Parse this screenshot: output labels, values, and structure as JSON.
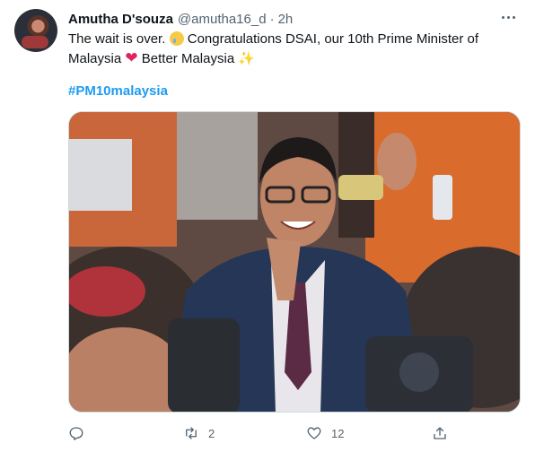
{
  "user": {
    "display_name": "Amutha D'souza",
    "handle": "@amutha16_d",
    "separator": "·",
    "time": "2h",
    "avatar_icon": "profile-avatar"
  },
  "tweet": {
    "line1": "The wait is over.",
    "line1b": "Congratulations DSAI, our 10th Prime Minister of",
    "line2": "Malaysia",
    "line2b": "Better Malaysia",
    "hashtag": "#PM10malaysia",
    "emojis": [
      "smiling-face-with-tear",
      "red-heart",
      "dizzy-sparkle"
    ]
  },
  "actions": {
    "reply_count": "",
    "retweet_count": "2",
    "like_count": "12",
    "icons": [
      "reply-icon",
      "retweet-icon",
      "like-icon",
      "share-icon"
    ]
  },
  "colors": {
    "link": "#1d9bf0",
    "muted": "#536471",
    "text": "#0f1419",
    "heart": "#e0245e"
  }
}
